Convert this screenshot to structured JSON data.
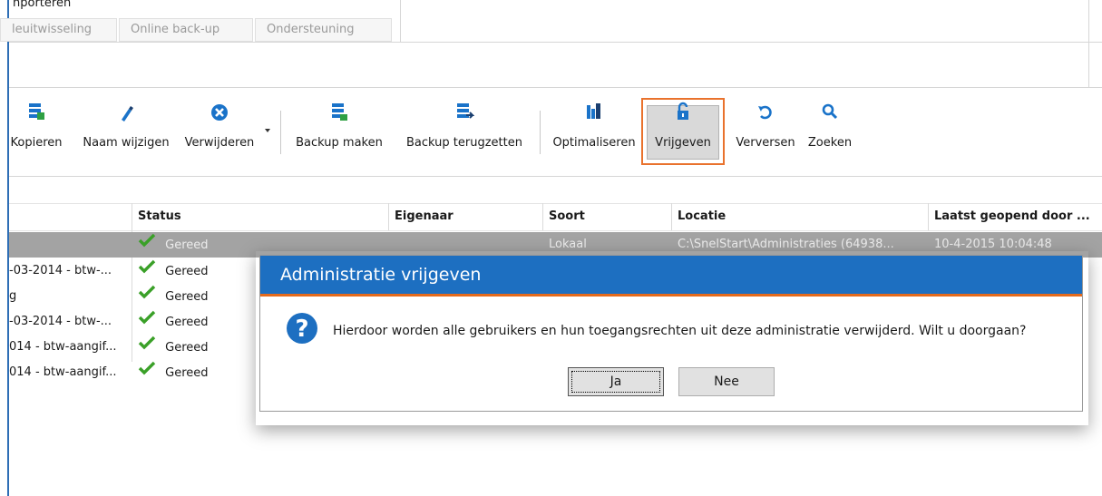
{
  "top": {
    "truncated_label": "nporteren",
    "tabs": [
      "leuitwisseling",
      "Online back-up",
      "Ondersteuning"
    ]
  },
  "toolbar": {
    "buttons": [
      {
        "label": "Kopieren",
        "icon": "copy-database-icon"
      },
      {
        "label": "Naam wijzigen",
        "icon": "pencil-icon"
      },
      {
        "label": "Verwijderen",
        "icon": "delete-circle-icon"
      },
      {
        "label": "Backup maken",
        "icon": "backup-make-icon"
      },
      {
        "label": "Backup terugzetten",
        "icon": "backup-restore-icon"
      },
      {
        "label": "Optimaliseren",
        "icon": "optimize-icon"
      },
      {
        "label": "Vrijgeven",
        "icon": "unlock-icon"
      },
      {
        "label": "Verversen",
        "icon": "refresh-icon"
      },
      {
        "label": "Zoeken",
        "icon": "search-icon"
      }
    ]
  },
  "grid": {
    "columns": [
      "Status",
      "Eigenaar",
      "Soort",
      "Locatie",
      "Laatst geopend door ..."
    ],
    "rows": [
      {
        "name": "",
        "status": "Gereed",
        "soort": "Lokaal",
        "locatie": "C:\\SnelStart\\Administraties (64938...",
        "laatst": "10-4-2015 10:04:48"
      },
      {
        "name": "-03-2014 - btw-...",
        "status": "Gereed"
      },
      {
        "name": "g",
        "status": "Gereed"
      },
      {
        "name": "-03-2014 - btw-...",
        "status": "Gereed"
      },
      {
        "name": "014 - btw-aangif...",
        "status": "Gereed"
      },
      {
        "name": "014 - btw-aangif...",
        "status": "Gereed"
      }
    ]
  },
  "dialog": {
    "title": "Administratie vrijgeven",
    "message": "Hierdoor worden alle gebruikers en hun toegangsrechten uit deze administratie verwijderd. Wilt u doorgaan?",
    "yes_label": "Ja",
    "no_label": "Nee"
  },
  "colors": {
    "accent_blue": "#1d6fc1",
    "accent_orange": "#e46a1c",
    "check_green": "#3aa028",
    "icon_blue": "#1a73c9"
  }
}
